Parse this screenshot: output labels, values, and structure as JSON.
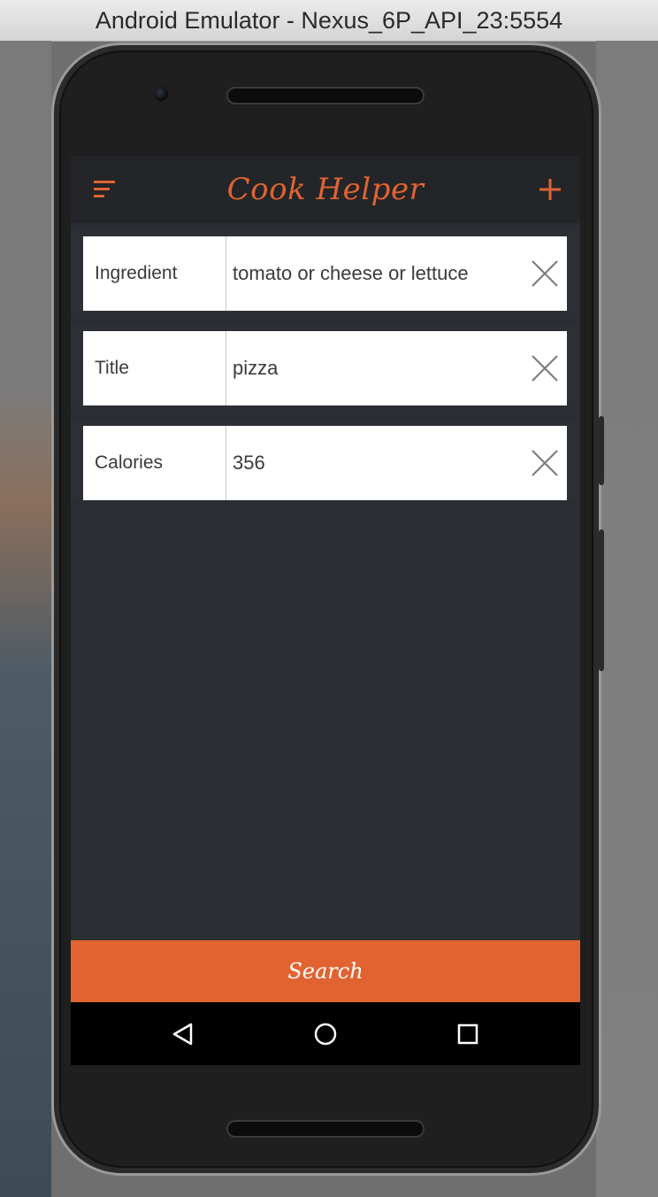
{
  "window": {
    "title": "Android Emulator - Nexus_6P_API_23:5554"
  },
  "app": {
    "title": "Cook Helper",
    "accent_color": "#e06331",
    "menu_icon": "menu-icon",
    "add_icon": "plus-icon"
  },
  "filters": [
    {
      "label": "Ingredient",
      "value": "tomato or cheese or lettuce",
      "clear_icon": "close-icon"
    },
    {
      "label": "Title",
      "value": "pizza",
      "clear_icon": "close-icon"
    },
    {
      "label": "Calories",
      "value": "356",
      "clear_icon": "close-icon"
    }
  ],
  "search_button": {
    "label": "Search"
  },
  "navigation": {
    "back_icon": "back-triangle-icon",
    "home_icon": "home-circle-icon",
    "recents_icon": "recents-square-icon"
  }
}
